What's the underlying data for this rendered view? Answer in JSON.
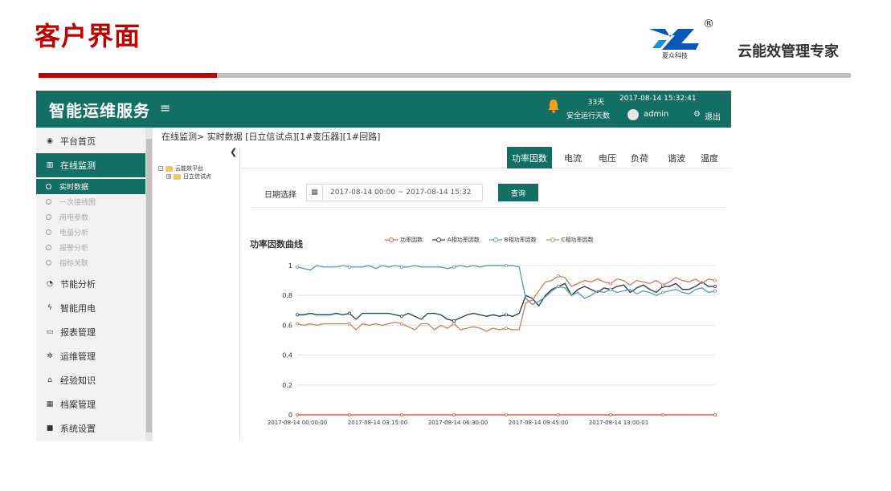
{
  "slide": {
    "title": "客户界面",
    "reg_mark": "®",
    "logo_text": "夏众科技",
    "slogan": "云能效管理专家"
  },
  "topbar": {
    "brand": "智能运维服务",
    "menu_icon": "≡",
    "safe_days": "33天",
    "safe_label": "安全运行天数",
    "datetime": "2017-08-14 15:32:41",
    "user": "admin",
    "logout": "退出",
    "accent_color": "#136f63"
  },
  "sidebar": {
    "items": [
      {
        "label": "平台首页",
        "icon": "dashboard-icon"
      },
      {
        "label": "在线监测",
        "icon": "bar-chart-icon",
        "active": true
      },
      {
        "label": "节能分析",
        "icon": "pie-chart-icon"
      },
      {
        "label": "智能用电",
        "icon": "bolt-icon"
      },
      {
        "label": "报表管理",
        "icon": "laptop-icon"
      },
      {
        "label": "运维管理",
        "icon": "gear-icon"
      },
      {
        "label": "经验知识",
        "icon": "home-icon"
      },
      {
        "label": "档案管理",
        "icon": "table-icon"
      },
      {
        "label": "系统设置",
        "icon": "folder-icon"
      }
    ],
    "sub_items": [
      {
        "label": "实时数据",
        "active": true
      },
      {
        "label": "一次接线图"
      },
      {
        "label": "用电参数"
      },
      {
        "label": "电量分析"
      },
      {
        "label": "报警分析"
      },
      {
        "label": "指标关联"
      }
    ]
  },
  "breadcrumb": "在线监测> 实时数据 [日立信试点][1#变压器][1#回路]",
  "tree": {
    "root": "云能效平台",
    "child": "日立信试点"
  },
  "tabs": [
    "功率因数",
    "电流",
    "电压",
    "负荷",
    "谐波",
    "温度"
  ],
  "filter": {
    "label": "日期选择",
    "date_range": "2017-08-14 00:00 ~ 2017-08-14 15:32",
    "query_button": "查询"
  },
  "chart_data": {
    "type": "line",
    "title": "功率因数曲线",
    "y_ticks": [
      "0",
      "0.2",
      "0.4",
      "0.6",
      "0.8",
      "1"
    ],
    "ylim": [
      0,
      1
    ],
    "x_ticks": [
      "2017-08-14 00:00:00",
      "2017-08-14 03:15:00",
      "2017-08-14 06:30:00",
      "2017-08-14 09:45:00",
      "2017-08-14 13:00:01"
    ],
    "legend_position": "top",
    "series": [
      {
        "name": "功率因数",
        "color": "#e2574c",
        "values": [
          0,
          0,
          0,
          0,
          0,
          0,
          0,
          0,
          0,
          0,
          0,
          0,
          0,
          0,
          0,
          0,
          0,
          0,
          0,
          0,
          0,
          0,
          0,
          0,
          0,
          0,
          0,
          0,
          0,
          0,
          0,
          0,
          0,
          0,
          0,
          0,
          0,
          0,
          0,
          0,
          0,
          0,
          0,
          0,
          0,
          0,
          0,
          0,
          0,
          0,
          0,
          0,
          0,
          0,
          0,
          0,
          0,
          0,
          0,
          0,
          0,
          0,
          0,
          0,
          0
        ]
      },
      {
        "name": "A相功率因数",
        "color": "#2f4554",
        "values": [
          0.67,
          0.67,
          0.68,
          0.67,
          0.67,
          0.67,
          0.68,
          0.67,
          0.68,
          0.64,
          0.68,
          0.68,
          0.68,
          0.68,
          0.68,
          0.67,
          0.66,
          0.68,
          0.66,
          0.64,
          0.68,
          0.68,
          0.67,
          0.64,
          0.63,
          0.65,
          0.67,
          0.68,
          0.67,
          0.66,
          0.67,
          0.66,
          0.67,
          0.66,
          0.68,
          0.8,
          0.78,
          0.73,
          0.8,
          0.84,
          0.86,
          0.88,
          0.8,
          0.84,
          0.86,
          0.84,
          0.82,
          0.85,
          0.84,
          0.86,
          0.87,
          0.82,
          0.85,
          0.87,
          0.84,
          0.82,
          0.86,
          0.86,
          0.88,
          0.84,
          0.84,
          0.86,
          0.89,
          0.86,
          0.86
        ]
      },
      {
        "name": "B相功率因数",
        "color": "#61a0a8",
        "values": [
          0.99,
          0.98,
          0.97,
          1.0,
          0.99,
          0.99,
          0.99,
          1.0,
          0.99,
          0.99,
          0.99,
          1.0,
          0.98,
          1.0,
          0.99,
          1.0,
          0.99,
          0.99,
          1.0,
          0.99,
          0.99,
          0.99,
          0.99,
          0.98,
          0.99,
          1.0,
          0.99,
          1.0,
          0.99,
          1.0,
          1.0,
          1.0,
          1.0,
          1.0,
          0.99,
          0.78,
          0.74,
          0.76,
          0.79,
          0.83,
          0.86,
          0.85,
          0.8,
          0.82,
          0.78,
          0.8,
          0.83,
          0.82,
          0.84,
          0.82,
          0.83,
          0.84,
          0.81,
          0.83,
          0.82,
          0.8,
          0.82,
          0.83,
          0.84,
          0.82,
          0.81,
          0.84,
          0.85,
          0.82,
          0.83
        ]
      },
      {
        "name": "C相功率因数",
        "color": "#d48265",
        "values": [
          0.61,
          0.6,
          0.61,
          0.6,
          0.61,
          0.61,
          0.61,
          0.61,
          0.61,
          0.57,
          0.61,
          0.6,
          0.61,
          0.6,
          0.61,
          0.62,
          0.61,
          0.59,
          0.57,
          0.61,
          0.61,
          0.57,
          0.6,
          0.58,
          0.61,
          0.57,
          0.58,
          0.59,
          0.58,
          0.56,
          0.58,
          0.57,
          0.58,
          0.57,
          0.57,
          0.75,
          0.77,
          0.83,
          0.89,
          0.9,
          0.93,
          0.92,
          0.86,
          0.88,
          0.9,
          0.89,
          0.91,
          0.89,
          0.88,
          0.91,
          0.9,
          0.87,
          0.9,
          0.89,
          0.88,
          0.9,
          0.87,
          0.89,
          0.92,
          0.9,
          0.89,
          0.91,
          0.88,
          0.91,
          0.9
        ]
      }
    ]
  }
}
